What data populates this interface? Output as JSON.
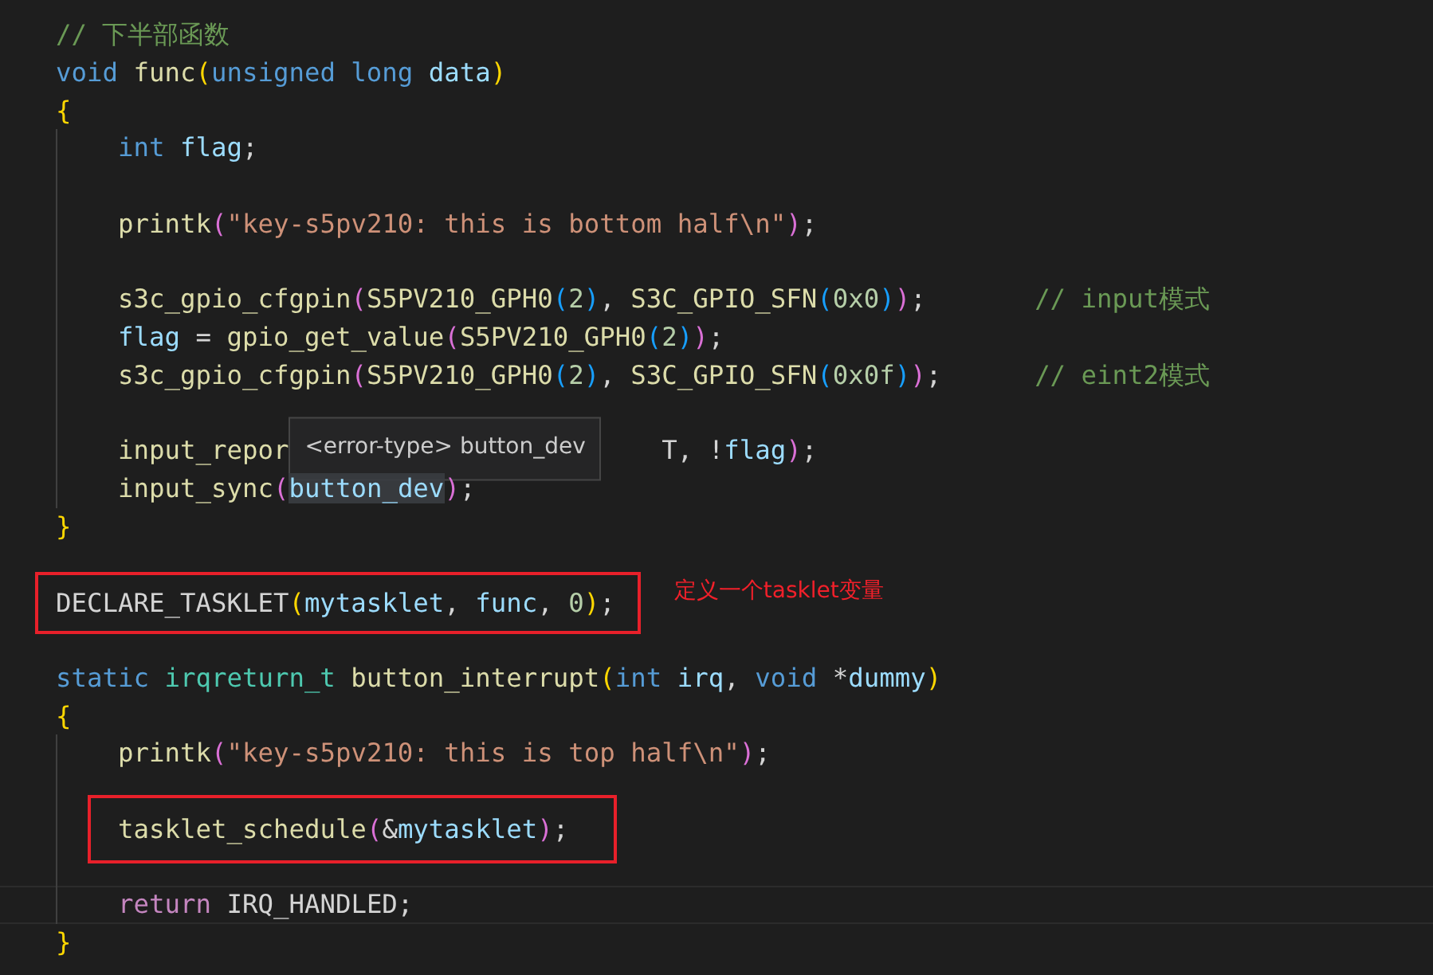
{
  "editor": {
    "lines": [
      {
        "indented": false,
        "space_before": false,
        "tokens": [
          {
            "kind": "c",
            "text": "// 下半部函数"
          }
        ]
      },
      {
        "indented": false,
        "space_before": false,
        "tokens": [
          {
            "kind": "k",
            "text": "void"
          },
          {
            "kind": "f",
            "text": " func"
          },
          {
            "kind": "b1",
            "text": "("
          },
          {
            "kind": "k",
            "text": "unsigned long"
          },
          {
            "kind": "v",
            "text": " data"
          },
          {
            "kind": "b1",
            "text": ")"
          }
        ]
      },
      {
        "indented": false,
        "space_before": false,
        "tokens": [
          {
            "kind": "b1",
            "text": "{"
          }
        ]
      },
      {
        "indented": true,
        "space_before": false,
        "tokens": [
          {
            "kind": "k",
            "text": "int"
          },
          {
            "kind": "v",
            "text": " flag"
          },
          {
            "kind": "p",
            "text": ";"
          }
        ]
      },
      {
        "indented": true,
        "space_before": true,
        "tokens": [
          {
            "kind": "f",
            "text": "printk"
          },
          {
            "kind": "b2",
            "text": "("
          },
          {
            "kind": "s",
            "text": "\"key-s5pv210: this is bottom half\\n\""
          },
          {
            "kind": "b2",
            "text": ")"
          },
          {
            "kind": "p",
            "text": ";"
          }
        ]
      },
      {
        "indented": true,
        "space_before": true,
        "tokens": [
          {
            "kind": "f",
            "text": "s3c_gpio_cfgpin"
          },
          {
            "kind": "b2",
            "text": "("
          },
          {
            "kind": "f",
            "text": "S5PV210_GPH0"
          },
          {
            "kind": "b3",
            "text": "("
          },
          {
            "kind": "n",
            "text": "2"
          },
          {
            "kind": "b3",
            "text": ")"
          },
          {
            "kind": "p",
            "text": ", "
          },
          {
            "kind": "f",
            "text": "S3C_GPIO_SFN"
          },
          {
            "kind": "b3",
            "text": "("
          },
          {
            "kind": "n",
            "text": "0x0"
          },
          {
            "kind": "b3",
            "text": ")"
          },
          {
            "kind": "b2",
            "text": ")"
          },
          {
            "kind": "p",
            "text": ";       "
          },
          {
            "kind": "c",
            "text": "// input模式"
          }
        ]
      },
      {
        "indented": true,
        "space_before": false,
        "tokens": [
          {
            "kind": "v",
            "text": "flag"
          },
          {
            "kind": "p",
            "text": " = "
          },
          {
            "kind": "f",
            "text": "gpio_get_value"
          },
          {
            "kind": "b2",
            "text": "("
          },
          {
            "kind": "f",
            "text": "S5PV210_GPH0"
          },
          {
            "kind": "b3",
            "text": "("
          },
          {
            "kind": "n",
            "text": "2"
          },
          {
            "kind": "b3",
            "text": ")"
          },
          {
            "kind": "b2",
            "text": ")"
          },
          {
            "kind": "p",
            "text": ";"
          }
        ]
      },
      {
        "indented": true,
        "space_before": false,
        "tokens": [
          {
            "kind": "f",
            "text": "s3c_gpio_cfgpin"
          },
          {
            "kind": "b2",
            "text": "("
          },
          {
            "kind": "f",
            "text": "S5PV210_GPH0"
          },
          {
            "kind": "b3",
            "text": "("
          },
          {
            "kind": "n",
            "text": "2"
          },
          {
            "kind": "b3",
            "text": ")"
          },
          {
            "kind": "p",
            "text": ", "
          },
          {
            "kind": "f",
            "text": "S3C_GPIO_SFN"
          },
          {
            "kind": "b3",
            "text": "("
          },
          {
            "kind": "n",
            "text": "0x0f"
          },
          {
            "kind": "b3",
            "text": ")"
          },
          {
            "kind": "b2",
            "text": ")"
          },
          {
            "kind": "p",
            "text": ";      "
          },
          {
            "kind": "c",
            "text": "// eint2模式"
          }
        ]
      },
      {
        "indented": true,
        "space_before": true,
        "tokens": [
          {
            "kind": "f",
            "text": "input_repor"
          },
          {
            "kind": "tooltip",
            "text": "<error-type> button_dev"
          },
          {
            "kind": "p",
            "text": "T, !"
          },
          {
            "kind": "v",
            "text": "flag"
          },
          {
            "kind": "b2",
            "text": ")"
          },
          {
            "kind": "p",
            "text": ";"
          }
        ]
      },
      {
        "indented": true,
        "space_before": false,
        "tokens": [
          {
            "kind": "f",
            "text": "input_sync"
          },
          {
            "kind": "b2",
            "text": "("
          },
          {
            "kind": "h",
            "text": "button_dev"
          },
          {
            "kind": "b2",
            "text": ")"
          },
          {
            "kind": "p",
            "text": ";"
          }
        ]
      },
      {
        "indented": false,
        "space_before": false,
        "tokens": [
          {
            "kind": "b1",
            "text": "}"
          }
        ]
      },
      {
        "indented": false,
        "space_before": true,
        "boxed": true,
        "note": "定义一个tasklet变量",
        "tokens": [
          {
            "kind": "p",
            "text": "DECLARE_TASKLET"
          },
          {
            "kind": "b1",
            "text": "("
          },
          {
            "kind": "v",
            "text": "mytasklet"
          },
          {
            "kind": "p",
            "text": ", "
          },
          {
            "kind": "v",
            "text": "func"
          },
          {
            "kind": "p",
            "text": ", "
          },
          {
            "kind": "n",
            "text": "0"
          },
          {
            "kind": "b1",
            "text": ")"
          },
          {
            "kind": "p",
            "text": ";"
          }
        ]
      },
      {
        "indented": false,
        "space_before": true,
        "tokens": [
          {
            "kind": "k",
            "text": "static"
          },
          {
            "kind": "t",
            "text": " irqreturn_t"
          },
          {
            "kind": "f",
            "text": " button_interrupt"
          },
          {
            "kind": "b1",
            "text": "("
          },
          {
            "kind": "k",
            "text": "int"
          },
          {
            "kind": "v",
            "text": " irq"
          },
          {
            "kind": "p",
            "text": ", "
          },
          {
            "kind": "k",
            "text": "void"
          },
          {
            "kind": "p",
            "text": " *"
          },
          {
            "kind": "v",
            "text": "dummy"
          },
          {
            "kind": "b1",
            "text": ")"
          }
        ]
      },
      {
        "indented": false,
        "space_before": false,
        "tokens": [
          {
            "kind": "b1",
            "text": "{"
          }
        ]
      },
      {
        "indented": true,
        "space_before": false,
        "tokens": [
          {
            "kind": "f",
            "text": "printk"
          },
          {
            "kind": "b2",
            "text": "("
          },
          {
            "kind": "s",
            "text": "\"key-s5pv210: this is top half\\n\""
          },
          {
            "kind": "b2",
            "text": ")"
          },
          {
            "kind": "p",
            "text": ";"
          }
        ]
      },
      {
        "indented": true,
        "space_before": true,
        "boxed": true,
        "tokens": [
          {
            "kind": "f",
            "text": "tasklet_schedule"
          },
          {
            "kind": "b2",
            "text": "("
          },
          {
            "kind": "p",
            "text": "&"
          },
          {
            "kind": "v",
            "text": "mytasklet"
          },
          {
            "kind": "b2",
            "text": ")"
          },
          {
            "kind": "p",
            "text": ";"
          }
        ]
      },
      {
        "indented": true,
        "space_before": true,
        "current": true,
        "tokens": [
          {
            "kind": "r",
            "text": "return"
          },
          {
            "kind": "p",
            "text": " IRQ_HANDLED;"
          }
        ]
      },
      {
        "indented": false,
        "space_before": false,
        "tokens": [
          {
            "kind": "b1",
            "text": "}"
          }
        ]
      }
    ]
  }
}
